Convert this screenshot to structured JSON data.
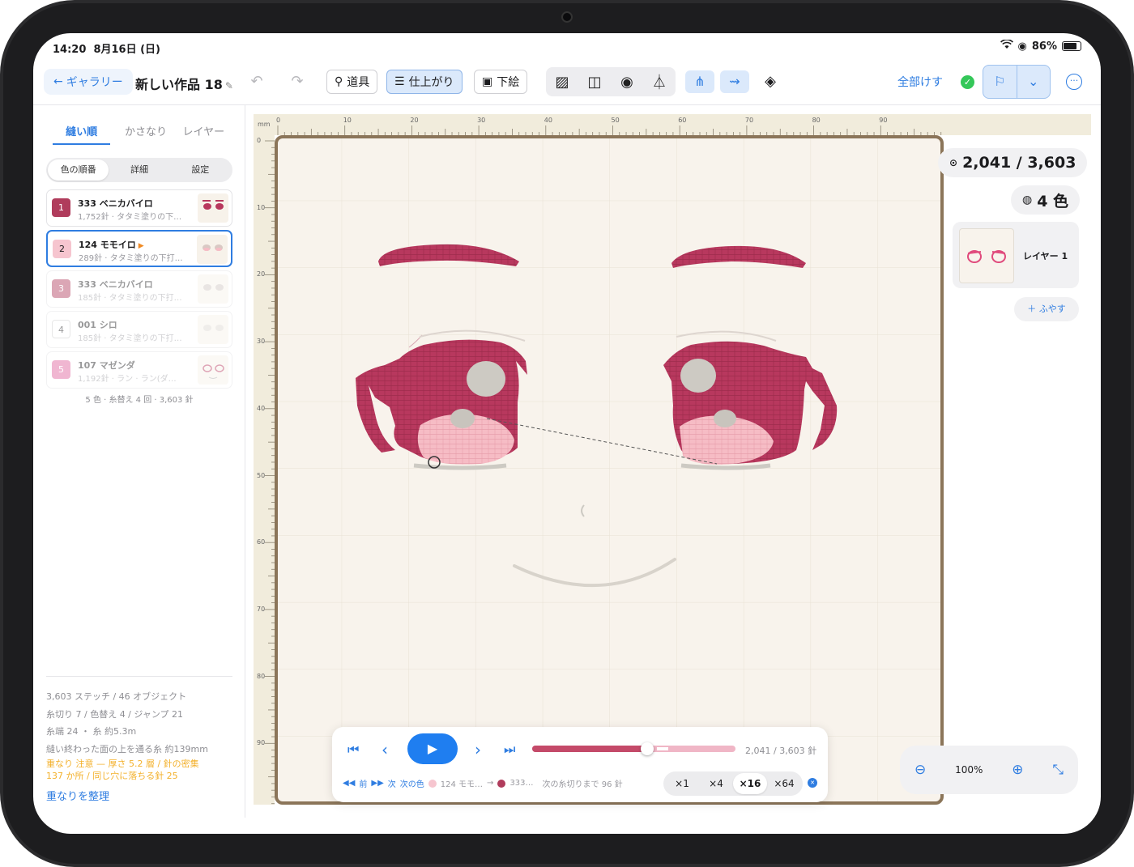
{
  "status_bar": {
    "time": "14:20",
    "date": "8月16日 (日)",
    "battery": "86%"
  },
  "toolbar": {
    "back_label": "ギャラリー",
    "doc_title": "新しい作品 18",
    "tool_label": "道具",
    "finish_label": "仕上がり",
    "sketch_label": "下絵",
    "erase_all_label": "全部けす"
  },
  "left_panel": {
    "tabs": [
      "縫い順",
      "かさなり",
      "レイヤー"
    ],
    "segments": [
      "色の順番",
      "詳細",
      "設定"
    ],
    "colors": [
      {
        "num": "1",
        "name": "333 ベニカバイロ",
        "sub": "1,752針 · タタミ塗りの下…",
        "color": "#b03c5c"
      },
      {
        "num": "2",
        "name": "124 モモイロ",
        "sub": "289針 · タタミ塗りの下打…",
        "color": "#f6c5cf"
      },
      {
        "num": "3",
        "name": "333 ベニカバイロ",
        "sub": "185針 · タタミ塗りの下打…",
        "color": "#b03c5c"
      },
      {
        "num": "4",
        "name": "001 シロ",
        "sub": "185針 · タタミ塗りの下打…",
        "color": "#ffffff"
      },
      {
        "num": "5",
        "name": "107 マゼンダ",
        "sub": "1,192針 · ラン · ラン(ダ…",
        "color": "#e0609a"
      }
    ],
    "list_summary": "5 色 · 糸替え 4 回 · 3,603 針",
    "stats": [
      "3,603 ステッチ / 46 オブジェクト",
      "糸切り 7 / 色替え 4 / ジャンプ 21",
      "糸端 24 ・ 糸 約5.3m",
      "縫い終わった面の上を通る糸 約139mm"
    ],
    "warning_1": "重なり 注意 — 厚さ 5.2 層 / 針の密集",
    "warning_2": "137 か所 / 同じ穴に落ちる針 25",
    "organize_label": "重なりを整理"
  },
  "canvas": {
    "ruler_unit": "mm",
    "ruler_x": [
      "0",
      "10",
      "20",
      "30",
      "40",
      "50",
      "60",
      "70",
      "80",
      "90"
    ],
    "ruler_y": [
      "0",
      "10",
      "20",
      "30",
      "40",
      "50",
      "60",
      "70",
      "80",
      "90"
    ],
    "thread_colors": {
      "crimson": "#b8385e",
      "pink": "#f6bcc5",
      "grey": "#cdcac3",
      "board": "#f8f3ec"
    }
  },
  "playback": {
    "count_label": "2,041 / 3,603 針",
    "progress": 0.566,
    "prev_label": "前",
    "next_label": "次",
    "next_color_label": "次の色",
    "current_color": "124 モモ…",
    "next_color": "333…",
    "remaining": "次の糸切りまで 96 針",
    "speeds": [
      "×1",
      "×4",
      "×16",
      "×64"
    ],
    "active_speed": "×16"
  },
  "right_panel": {
    "stitch_count": "2,041 / 3,603",
    "color_count": "4 色",
    "layer_name": "レイヤー 1",
    "add_layer": "ふやす",
    "zoom": "100%"
  }
}
